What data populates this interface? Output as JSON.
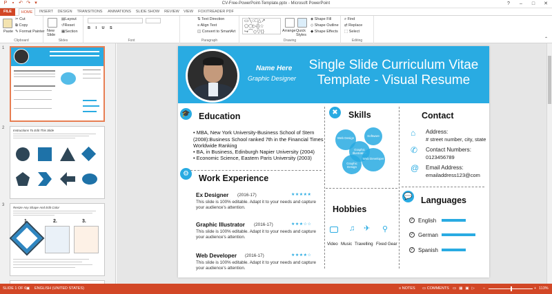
{
  "window": {
    "title": "CV-Free-PowerPoint-Template.pptx - Microsoft PowerPoint"
  },
  "tabs": [
    "FILE",
    "HOME",
    "INSERT",
    "DESIGN",
    "TRANSITIONS",
    "ANIMATIONS",
    "SLIDE SHOW",
    "REVIEW",
    "VIEW",
    "FOXITREADER PDF"
  ],
  "ribbon": {
    "clipboard": {
      "paste": "Paste",
      "cut": "Cut",
      "copy": "Copy",
      "format_painter": "Format Painter",
      "label": "Clipboard"
    },
    "slides": {
      "new_slide": "New Slide",
      "layout": "Layout",
      "reset": "Reset",
      "section": "Section",
      "label": "Slides"
    },
    "font": {
      "label": "Font"
    },
    "paragraph": {
      "text_direction": "Text Direction",
      "align_text": "Align Text",
      "convert": "Convert to SmartArt",
      "label": "Paragraph"
    },
    "drawing": {
      "arrange": "Arrange",
      "quick_styles": "Quick Styles",
      "shape_fill": "Shape Fill",
      "shape_outline": "Shape Outline",
      "shape_effects": "Shape Effects",
      "label": "Drawing"
    },
    "editing": {
      "find": "Find",
      "replace": "Replace",
      "select": "Select",
      "label": "Editing"
    }
  },
  "thumbnails": {
    "t1": {
      "num": "1"
    },
    "t2": {
      "num": "2",
      "title": "Instructions To Edit This Slide"
    },
    "t3": {
      "num": "3",
      "title": "Resize Any Shape And Edit Color",
      "steps": [
        "1.",
        "2.",
        "3."
      ]
    }
  },
  "slide": {
    "name": "Name Here",
    "role": "Graphic Designer",
    "title": "Single Slide Curriculum Vitae Template - Visual Resume",
    "education": {
      "heading": "Education",
      "items": [
        "MBA, New York University-Business School of Stern (2008):Business School ranked 7th in the Financial Times Worldwide Ranking",
        "BA, in Business, Edinburgh Napier University (2004)",
        "Economic Science, Eastern Paris University (2003)"
      ]
    },
    "work": {
      "heading": "Work Experience",
      "jobs": [
        {
          "title": "Ex Designer",
          "dates": "(2016-17)",
          "stars": "★★★★★",
          "text": "This slide is 100% editable. Adapt it to your needs and capture your audience's attention."
        },
        {
          "title": "Graphic Illustrator",
          "dates": "(2016-17)",
          "stars": "★★★☆☆",
          "text": "This slide is 100% editable. Adapt it to your needs and capture your audience's attention."
        },
        {
          "title": "Web Developer",
          "dates": "(2016-17)",
          "stars": "★★★★☆",
          "text": "This slide is 100% editable. Adapt it to your needs and capture your audience's attention."
        }
      ]
    },
    "skills": {
      "heading": "Skills",
      "bubbles": [
        "Web Design",
        "Software",
        "Graphic Illustration",
        "Graphic Design",
        "Web Developer"
      ]
    },
    "hobbies": {
      "heading": "Hobbies",
      "items": [
        "Video",
        "Music",
        "Travelling",
        "Fixed Gear"
      ]
    },
    "contact": {
      "heading": "Contact",
      "address_label": "Address:",
      "address": "# street number, city, state",
      "phone_label": "Contact Numbers:",
      "phone": "0123456789",
      "email_label": "Email Address:",
      "email": "emailaddress123@com"
    },
    "languages": {
      "heading": "Languages",
      "items": [
        {
          "name": "English",
          "level": 0.6
        },
        {
          "name": "German",
          "level": 0.85
        },
        {
          "name": "Spanish",
          "level": 0.6
        }
      ]
    }
  },
  "status": {
    "slide": "SLIDE 1 OF 6",
    "language": "ENGLISH (UNITED STATES)",
    "notes": "NOTES",
    "comments": "COMMENTS",
    "zoom": "113%"
  }
}
